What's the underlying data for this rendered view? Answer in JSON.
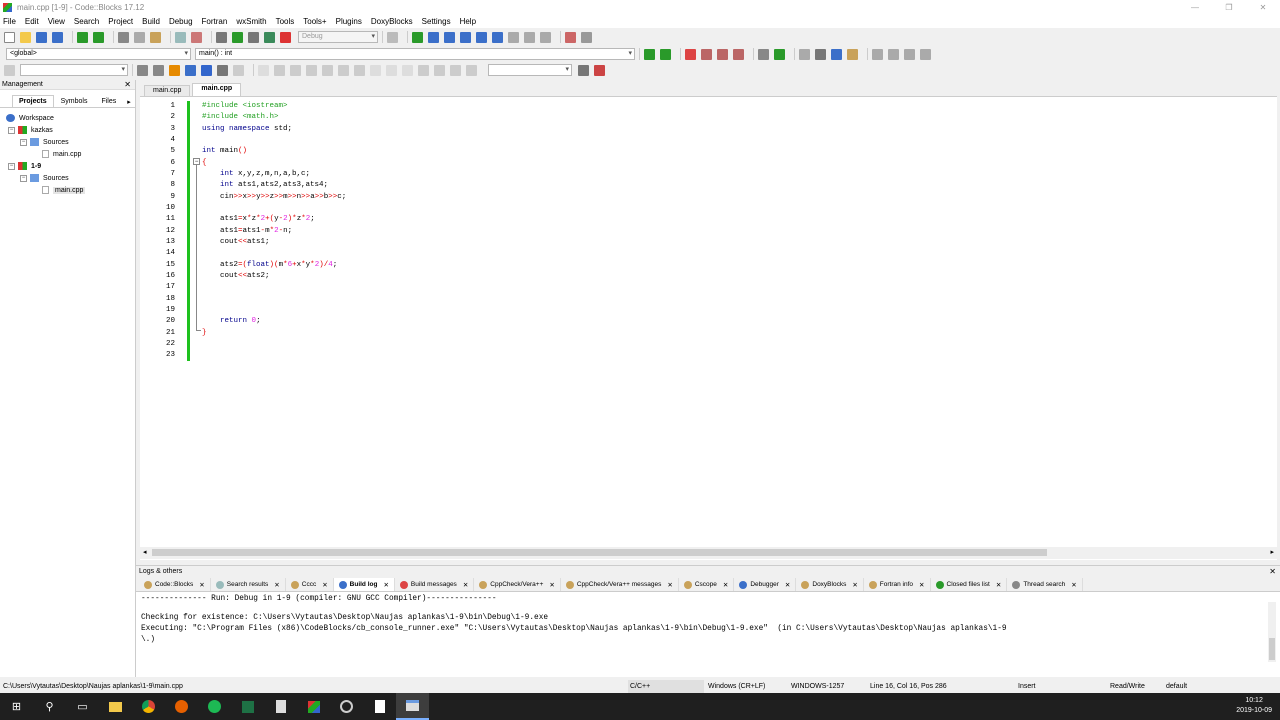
{
  "window": {
    "title": "main.cpp [1-9] - Code::Blocks 17.12"
  },
  "menu": [
    "File",
    "Edit",
    "View",
    "Search",
    "Project",
    "Build",
    "Debug",
    "Fortran",
    "wxSmith",
    "Tools",
    "Tools+",
    "Plugins",
    "DoxyBlocks",
    "Settings",
    "Help"
  ],
  "toolbar": {
    "build_target": "Debug",
    "scope": "<global>",
    "function": "main() : int"
  },
  "management": {
    "title": "Management",
    "tabs": [
      "Projects",
      "Symbols",
      "Files"
    ],
    "tree": {
      "workspace": "Workspace",
      "p1": "kazkas",
      "p1_sources": "Sources",
      "p1_file": "main.cpp",
      "p2": "1-9",
      "p2_sources": "Sources",
      "p2_file": "main.cpp"
    }
  },
  "editor": {
    "tabs": [
      "main.cpp",
      "main.cpp"
    ],
    "line_numbers": [
      "1",
      "2",
      "3",
      "4",
      "5",
      "6",
      "7",
      "8",
      "9",
      "10",
      "11",
      "12",
      "13",
      "14",
      "15",
      "16",
      "17",
      "18",
      "19",
      "20",
      "21",
      "22",
      "23"
    ]
  },
  "logs": {
    "title": "Logs & others",
    "tabs": [
      "Code::Blocks",
      "Search results",
      "Cccc",
      "Build log",
      "Build messages",
      "CppCheck/Vera++",
      "CppCheck/Vera++ messages",
      "Cscope",
      "Debugger",
      "DoxyBlocks",
      "Fortran info",
      "Closed files list",
      "Thread search"
    ],
    "lines": [
      "-------------- Run: Debug in 1-9 (compiler: GNU GCC Compiler)---------------",
      "",
      "Checking for existence: C:\\Users\\Vytautas\\Desktop\\Naujas aplankas\\1-9\\bin\\Debug\\1-9.exe",
      "Executing: \"C:\\Program Files (x86)\\CodeBlocks/cb_console_runner.exe\" \"C:\\Users\\Vytautas\\Desktop\\Naujas aplankas\\1-9\\bin\\Debug\\1-9.exe\"  (in C:\\Users\\Vytautas\\Desktop\\Naujas aplankas\\1-9",
      "\\.)"
    ]
  },
  "status": {
    "path": "C:\\Users\\Vytautas\\Desktop\\Naujas aplankas\\1-9\\main.cpp",
    "lang": "C/C++",
    "eol": "Windows (CR+LF)",
    "encoding": "WINDOWS-1257",
    "position": "Line 16, Col 16, Pos 286",
    "mode": "Insert",
    "access": "Read/Write",
    "theme": "default"
  },
  "taskbar": {
    "time": "10:12",
    "date": "2019-10-09"
  },
  "colors": {
    "preprocessor": "#22a022",
    "keyword": "#00008b",
    "operator": "#e00000",
    "number": "#e020e0",
    "change_bar": "#1ec11e"
  }
}
